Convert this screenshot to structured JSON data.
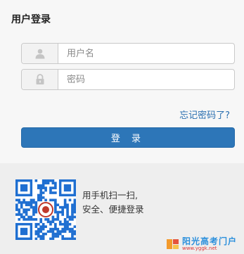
{
  "login": {
    "title": "用户登录",
    "username_placeholder": "用户名",
    "password_placeholder": "密码",
    "forgot_link": "忘记密码了?",
    "login_button": "登 录"
  },
  "qr": {
    "line1": "用手机扫一扫,",
    "line2": "安全、便捷登录"
  },
  "watermark": {
    "title": "阳光高考门户",
    "url": "www.yggk.net"
  },
  "icons": {
    "user": "user-icon",
    "lock": "lock-icon",
    "qr": "qr-code-icon"
  }
}
